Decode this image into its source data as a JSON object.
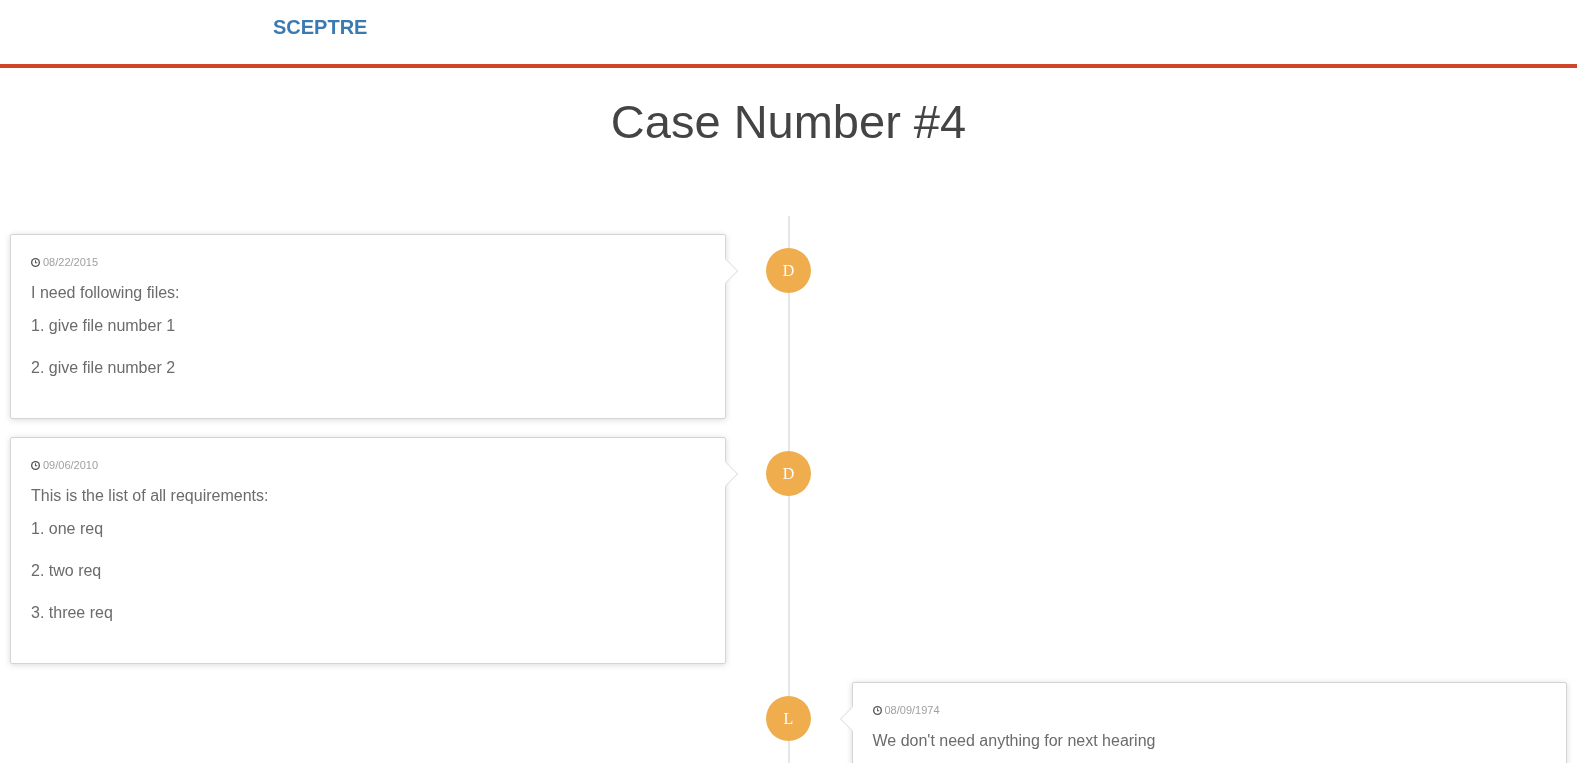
{
  "navbar": {
    "brand": "SCEPTRE"
  },
  "page": {
    "title": "Case Number #4"
  },
  "timeline": [
    {
      "inverted": false,
      "badge": "D",
      "date": "08/22/2015",
      "heading": "I need following files:",
      "items": [
        "1. give file number 1",
        "2. give file number 2"
      ]
    },
    {
      "inverted": false,
      "badge": "D",
      "date": "09/06/2010",
      "heading": "This is the list of all requirements:",
      "items": [
        "1. one req",
        "2. two req",
        "3. three req"
      ]
    },
    {
      "inverted": true,
      "badge": "L",
      "date": "08/09/1974",
      "heading": "We don't need anything for next hearing"
    }
  ]
}
